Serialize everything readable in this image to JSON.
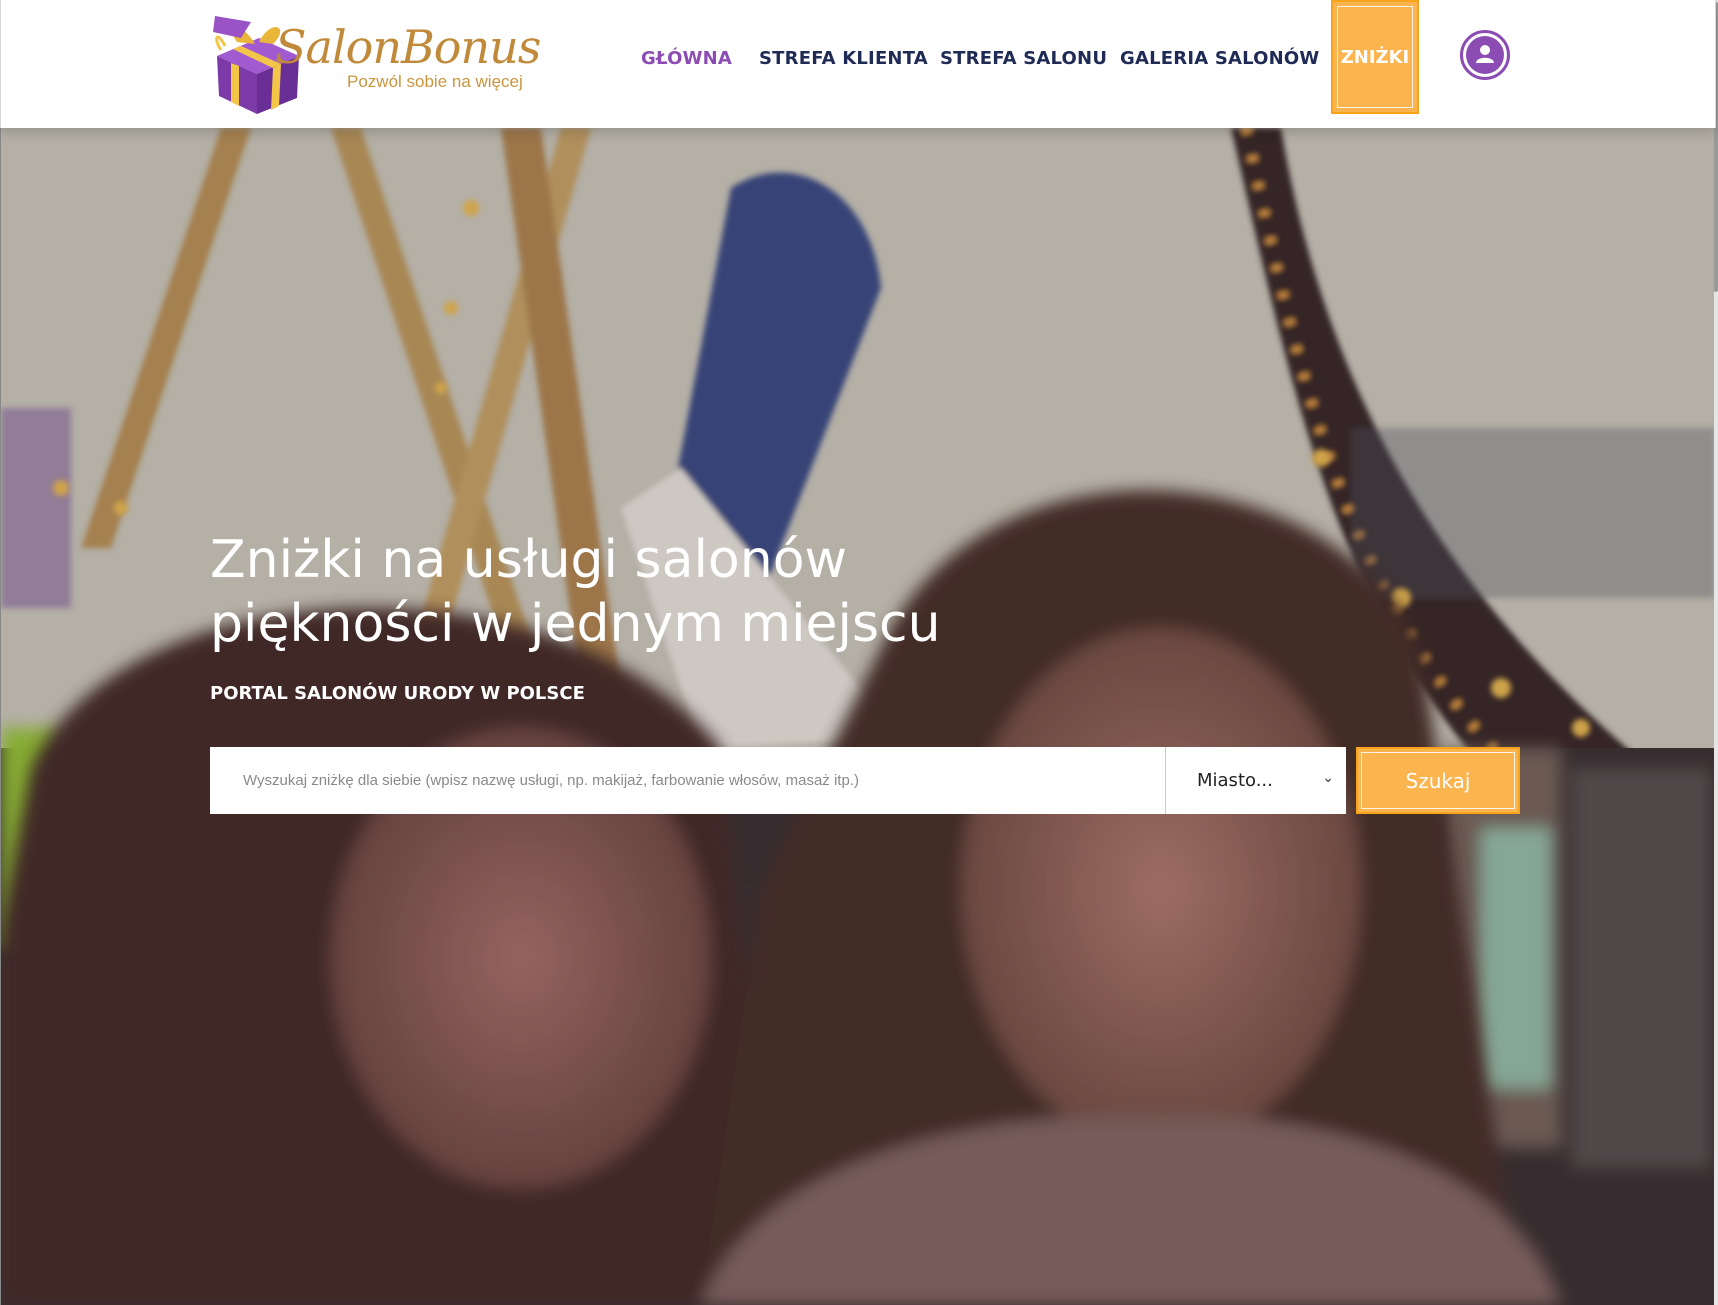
{
  "logo": {
    "name": "SalonBonus",
    "tagline": "Pozwól sobie na więcej"
  },
  "nav": {
    "items": [
      {
        "label": "GŁÓWNA",
        "active": true
      },
      {
        "label": "STREFA KLIENTA",
        "active": false
      },
      {
        "label": "STREFA SALONU",
        "active": false
      },
      {
        "label": "GALERIA SALONÓW",
        "active": false
      }
    ],
    "promo_label": "ZNIŻKI",
    "user_icon": "user-icon"
  },
  "hero": {
    "title_line1": "Zniżki na usługi salonów",
    "title_line2": "piękności w jednym miejscu",
    "subtitle": "PORTAL SALONÓW URODY W POLSCE"
  },
  "search": {
    "placeholder": "Wyszukaj zniżkę dla siebie (wpisz nazwę usługi, np. makijaż, farbowanie włosów, masaż itp.)",
    "value": "",
    "city_selected": "Miasto...",
    "button_label": "Szukaj"
  },
  "colors": {
    "accent_purple": "#8b4db3",
    "accent_orange": "#fbb44e",
    "nav_text": "#1f2b55",
    "logo_gold": "#c08a3a"
  }
}
